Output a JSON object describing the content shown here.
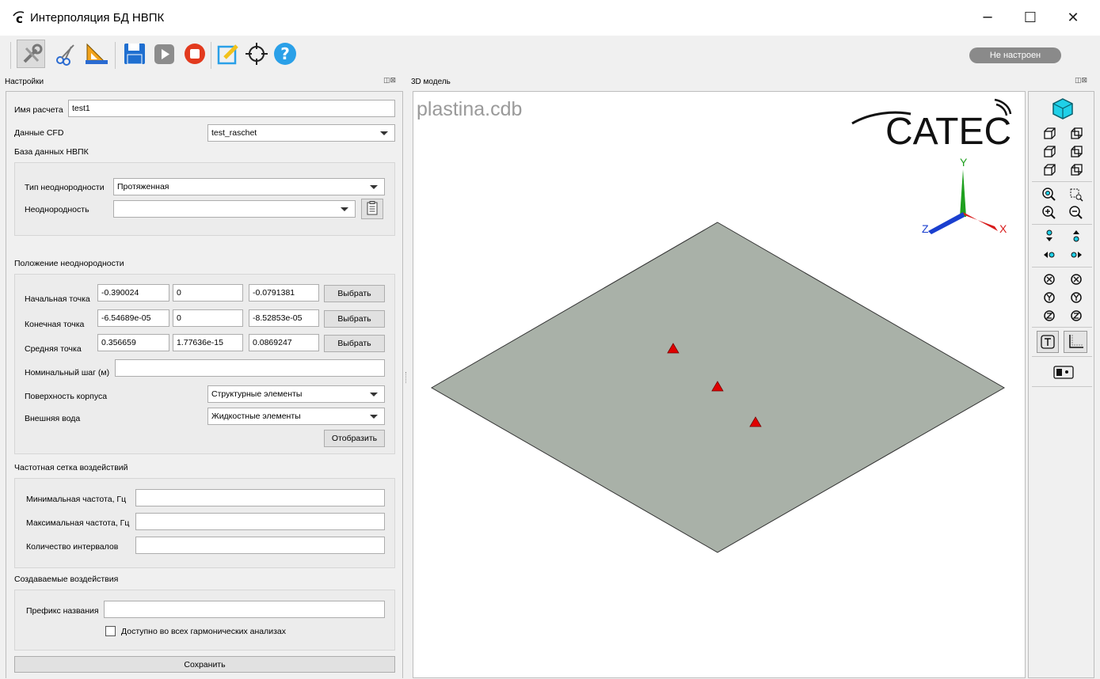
{
  "window": {
    "title": "Интерполяция БД НВПК",
    "controls": [
      "─",
      "☐",
      "✕"
    ]
  },
  "toolbar": {
    "icons": [
      "settings-wrench-icon",
      "cut-icon",
      "ruler-triangle-icon",
      "save-icon",
      "play-icon",
      "stop-icon",
      "edit-icon",
      "target-icon",
      "help-icon"
    ],
    "status": "Не настроен",
    "status_color": "#8a8a8a"
  },
  "settings_panel": {
    "title": "Настройки",
    "dock_buttons": "◫⊠",
    "calc_name_label": "Имя расчета",
    "calc_name_value": "test1",
    "cfd_label": "Данные CFD",
    "cfd_value": "test_raschet",
    "db_section": "База данных НВПК",
    "inhomogeneity_type_label": "Тип неоднородности",
    "inhomogeneity_type_value": "Протяженная",
    "inhomogeneity_label": "Неоднородность",
    "inhomogeneity_value": "",
    "position_section": "Положение неоднородности",
    "start_point_label": "Начальная точка",
    "start_point": [
      "-0.390024",
      "0",
      "-0.0791381"
    ],
    "end_point_label": "Конечная точка",
    "end_point": [
      "-6.54689e-05",
      "0",
      "-8.52853e-05"
    ],
    "mid_point_label": "Средняя точка",
    "mid_point": [
      "0.356659",
      "1.77636e-15",
      "0.0869247"
    ],
    "select_label": "Выбрать",
    "nominal_step_label": "Номинальный шаг (м)",
    "nominal_step_value": "",
    "hull_surface_label": "Поверхность корпуса",
    "hull_surface_value": "Структурные элементы",
    "outer_water_label": "Внешняя вода",
    "outer_water_value": "Жидкостные элементы",
    "display_label": "Отобразить",
    "freq_section": "Частотная сетка воздействий",
    "min_freq_label": "Минимальная частота, Гц",
    "max_freq_label": "Максимальная частота, Гц",
    "intervals_label": "Количество интервалов",
    "min_freq_value": "",
    "max_freq_value": "",
    "intervals_value": "",
    "created_section": "Создаваемые воздействия",
    "prefix_label": "Префикс названия",
    "prefix_value": "",
    "all_harmonic_label": "Доступно во всех гармонических анализах",
    "all_harmonic_checked": false,
    "save_label": "Сохранить"
  },
  "model_panel": {
    "title": "3D модель",
    "dock_buttons": "◫⊠",
    "file_name": "plastina.cdb",
    "brand": "CATEC",
    "axes": {
      "x": "X",
      "y": "Y",
      "z": "Z"
    },
    "plate_color": "#a9b1a8",
    "marker_color": "#e00000",
    "view_tools": [
      "iso-view-icon",
      "front-view-icon",
      "back-view-icon",
      "left-view-icon",
      "right-view-icon",
      "top-view-icon",
      "bottom-view-icon",
      "zoom-fit-icon",
      "zoom-box-icon",
      "zoom-in-icon",
      "zoom-out-icon",
      "pan-down-icon",
      "pan-up-icon",
      "pan-left-icon",
      "pan-right-icon",
      "rotate-x-neg-icon",
      "rotate-x-pos-icon",
      "rotate-y-neg-icon",
      "rotate-y-pos-icon",
      "rotate-z-neg-icon",
      "rotate-z-pos-icon",
      "text-toggle-icon",
      "axes-toggle-icon",
      "screenshot-icon"
    ]
  }
}
